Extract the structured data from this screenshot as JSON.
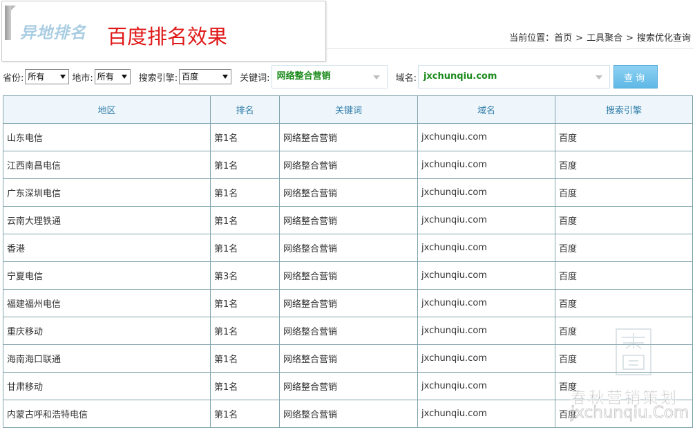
{
  "header": {
    "logo_text": "异地排名",
    "title": "百度排名效果",
    "breadcrumb": {
      "prefix": "当前位置：",
      "items": [
        "首页",
        "工具聚合",
        "搜索优化查询"
      ],
      "separator": ">"
    }
  },
  "filters": {
    "province": {
      "label": "省份:",
      "value": "所有"
    },
    "city": {
      "label": "地市:",
      "value": "所有"
    },
    "engine": {
      "label": "搜索引擎:",
      "value": "百度"
    },
    "keyword": {
      "label": "关键词:",
      "value": "网络整合营销"
    },
    "domain": {
      "label": "域名:",
      "value": "jxchunqiu.com"
    },
    "query_button": "查询"
  },
  "table": {
    "headers": [
      "地区",
      "排名",
      "关键词",
      "域名",
      "搜索引擎"
    ],
    "rows": [
      [
        "山东电信",
        "第1名",
        "网络整合营销",
        "jxchunqiu.com",
        "百度"
      ],
      [
        "江西南昌电信",
        "第1名",
        "网络整合营销",
        "jxchunqiu.com",
        "百度"
      ],
      [
        "广东深圳电信",
        "第1名",
        "网络整合营销",
        "jxchunqiu.com",
        "百度"
      ],
      [
        "云南大理铁通",
        "第1名",
        "网络整合营销",
        "jxchunqiu.com",
        "百度"
      ],
      [
        "香港",
        "第1名",
        "网络整合营销",
        "jxchunqiu.com",
        "百度"
      ],
      [
        "宁夏电信",
        "第3名",
        "网络整合营销",
        "jxchunqiu.com",
        "百度"
      ],
      [
        "福建福州电信",
        "第1名",
        "网络整合营销",
        "jxchunqiu.com",
        "百度"
      ],
      [
        "重庆移动",
        "第1名",
        "网络整合营销",
        "jxchunqiu.com",
        "百度"
      ],
      [
        "海南海口联通",
        "第1名",
        "网络整合营销",
        "jxchunqiu.com",
        "百度"
      ],
      [
        "甘肃移动",
        "第1名",
        "网络整合营销",
        "jxchunqiu.com",
        "百度"
      ],
      [
        "内蒙古呼和浩特电信",
        "第1名",
        "网络整合营销",
        "jxchunqiu.com",
        "百度"
      ]
    ]
  },
  "watermark": {
    "cn": "春秋营销策划",
    "en": "jxchunqiu.Com"
  },
  "colors": {
    "title_red": "#e01818",
    "header_blue": "#2f7ca8",
    "keyword_green": "#1c8a1c",
    "button_blue": "#5fb8e6",
    "border": "#7fa2ab"
  }
}
